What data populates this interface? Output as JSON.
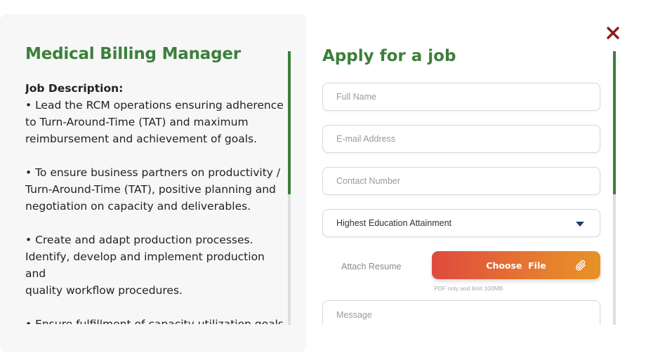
{
  "job": {
    "title": "Medical Billing Manager",
    "description_heading": "Job Description:",
    "paragraphs": [
      "• Lead the RCM operations ensuring adherence\nto Turn-Around-Time (TAT) and maximum\nreimbursement and achievement of goals.",
      "• To ensure business partners on productivity /\nTurn-Around-Time (TAT), positive planning and\nnegotiation on capacity and deliverables.",
      "• Create and adapt production processes.\nIdentify, develop and implement production and\nquality workflow procedures.",
      "• Ensure fulfillment of capacity utilization goals\nthrough stern adherence to Turn-Around-Time"
    ]
  },
  "form": {
    "title": "Apply for a job",
    "full_name_placeholder": "Full Name",
    "email_placeholder": "E-mail Address",
    "contact_placeholder": "Contact Number",
    "education_placeholder": "Highest Education Attainment",
    "resume_label": "Attach Resume",
    "choose_file_label": "Choose  File",
    "file_hint": "PDF only and limit 100MB",
    "message_placeholder": "Message"
  },
  "icons": {
    "close": "close-icon",
    "paperclip": "paperclip-icon",
    "dropdown": "chevron-down-icon"
  },
  "colors": {
    "accent_green": "#3c7f3c",
    "close_red": "#8b1d1d",
    "button_gradient_start": "#df4a3f",
    "button_gradient_end": "#e89127",
    "dropdown_arrow": "#1c3a6b"
  }
}
